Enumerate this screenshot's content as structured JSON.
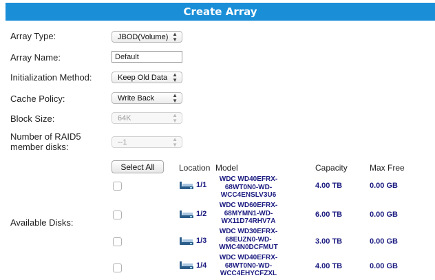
{
  "title": "Create Array",
  "fields": {
    "array_type": {
      "label": "Array Type:",
      "value": "JBOD(Volume)"
    },
    "array_name": {
      "label": "Array Name:",
      "value": "Default"
    },
    "init_method": {
      "label": "Initialization Method:",
      "value": "Keep Old Data"
    },
    "cache_policy": {
      "label": "Cache Policy:",
      "value": "Write Back"
    },
    "block_size": {
      "label": "Block Size:",
      "value": "64K"
    },
    "raid5_disks": {
      "label_line1": "Number of RAID5",
      "label_line2": "member disks:",
      "value": "--1"
    }
  },
  "available_disks": {
    "label": "Available Disks:",
    "select_all_label": "Select All",
    "columns": {
      "location": "Location",
      "model": "Model",
      "capacity": "Capacity",
      "max_free": "Max Free"
    },
    "rows": [
      {
        "location": "1/1",
        "model": [
          "WDC WD40EFRX-",
          "68WT0N0-WD-",
          "WCC4ENSLV3U6"
        ],
        "capacity": "4.00 TB",
        "max_free": "0.00 GB"
      },
      {
        "location": "1/2",
        "model": [
          "WDC WD60EFRX-",
          "68MYMN1-WD-",
          "WX11D74RHV7A"
        ],
        "capacity": "6.00 TB",
        "max_free": "0.00 GB"
      },
      {
        "location": "1/3",
        "model": [
          "WDC WD30EFRX-",
          "68EUZN0-WD-",
          "WMC4N0DCFMUT"
        ],
        "capacity": "3.00 TB",
        "max_free": "0.00 GB"
      },
      {
        "location": "1/4",
        "model": [
          "WDC WD40EFRX-",
          "68WT0N0-WD-",
          "WCC4EHYCFZXL"
        ],
        "capacity": "4.00 TB",
        "max_free": "0.00 GB"
      }
    ]
  },
  "icons": {
    "disk": "hard-disk-icon",
    "dropdown": "chevron-updown-icon"
  },
  "colors": {
    "header_bg": "#1a8fd8",
    "disk_text": "#1a1a80"
  }
}
